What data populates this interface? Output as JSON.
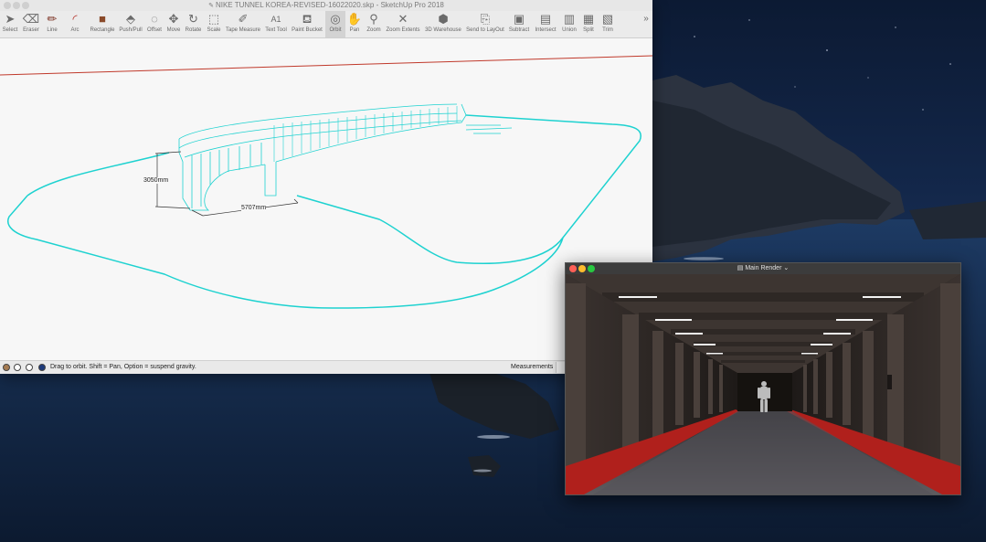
{
  "sketchup": {
    "title": "NIKE TUNNEL KOREA-REVISED-16022020.skp - SketchUp Pro 2018",
    "tools": [
      {
        "label": "Select",
        "icon": "arrow-icon"
      },
      {
        "label": "Eraser",
        "icon": "eraser-icon"
      },
      {
        "label": "Line",
        "icon": "pencil-icon"
      },
      {
        "label": "Arc",
        "icon": "arc-icon"
      },
      {
        "label": "Rectangle",
        "icon": "rectangle-icon"
      },
      {
        "label": "Push/Pull",
        "icon": "pushpull-icon"
      },
      {
        "label": "Offset",
        "icon": "offset-icon"
      },
      {
        "label": "Move",
        "icon": "move-icon"
      },
      {
        "label": "Rotate",
        "icon": "rotate-icon"
      },
      {
        "label": "Scale",
        "icon": "scale-icon"
      },
      {
        "label": "Tape Measure",
        "icon": "tape-measure-icon"
      },
      {
        "label": "Text Tool",
        "icon": "text-tool-icon"
      },
      {
        "label": "Paint Bucket",
        "icon": "paint-bucket-icon"
      },
      {
        "label": "Orbit",
        "icon": "orbit-icon"
      },
      {
        "label": "Pan",
        "icon": "pan-icon"
      },
      {
        "label": "Zoom",
        "icon": "zoom-icon"
      },
      {
        "label": "Zoom Extents",
        "icon": "zoom-extents-icon"
      },
      {
        "label": "3D Warehouse",
        "icon": "warehouse-icon"
      },
      {
        "label": "Send to LayOut",
        "icon": "layout-icon"
      },
      {
        "label": "Subtract",
        "icon": "subtract-icon"
      },
      {
        "label": "Intersect",
        "icon": "intersect-icon"
      },
      {
        "label": "Union",
        "icon": "union-icon"
      },
      {
        "label": "Split",
        "icon": "split-icon"
      },
      {
        "label": "Trim",
        "icon": "trim-icon"
      }
    ],
    "overflow_label": "»",
    "dimensions": {
      "height_label": "3050mm",
      "width_label": "5707mm"
    },
    "status_hint": "Drag to orbit. Shift = Pan, Option = suspend gravity.",
    "measurements_label": "Measurements",
    "model_color": "#1ed2d0",
    "axis_color": "#c0392b"
  },
  "render_window": {
    "title": "Main Render",
    "title_chevron": "⌄",
    "accent_red": "#b0201c"
  }
}
